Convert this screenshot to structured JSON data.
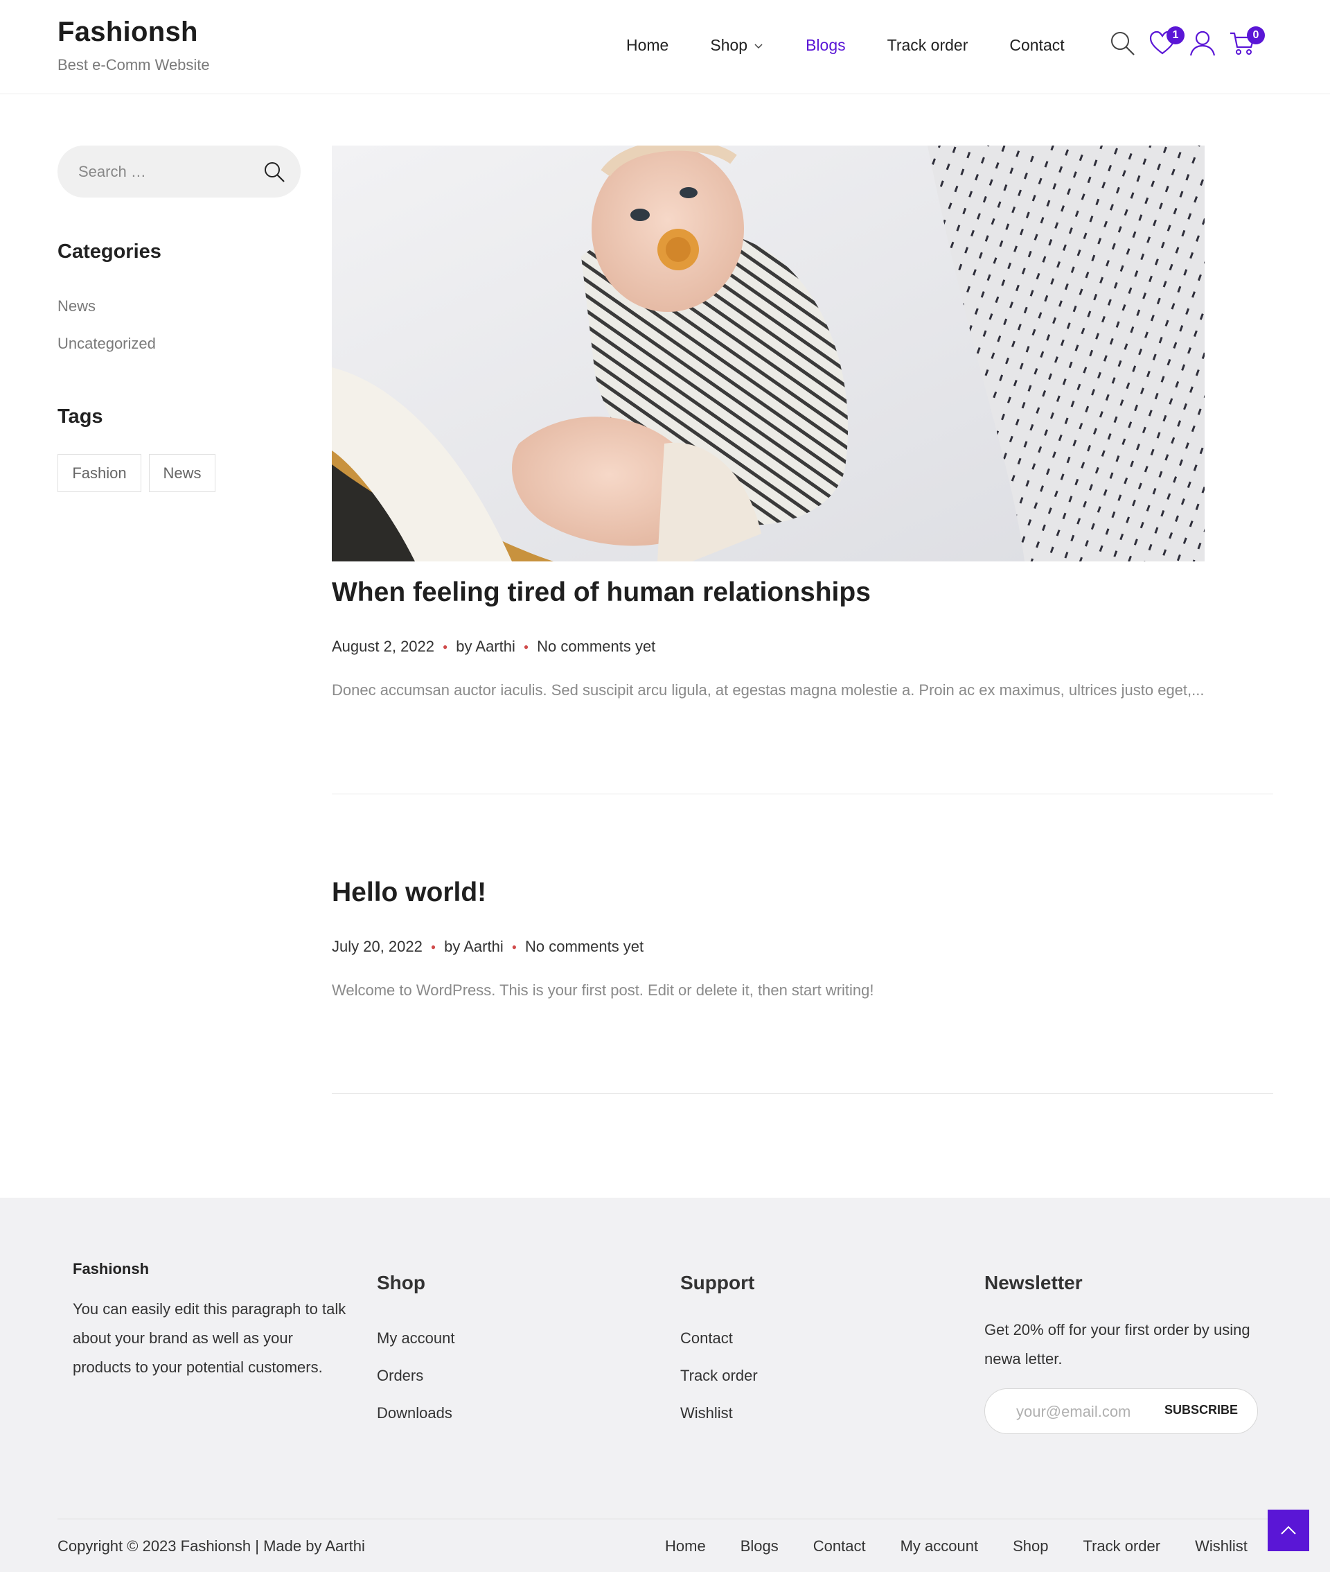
{
  "header": {
    "site_title": "Fashionsh",
    "tagline": "Best e-Comm Website",
    "nav": [
      {
        "label": "Home"
      },
      {
        "label": "Shop"
      },
      {
        "label": "Blogs"
      },
      {
        "label": "Track order"
      },
      {
        "label": "Contact"
      }
    ],
    "wishlist_count": "1",
    "cart_count": "0",
    "accent_color": "#5a16d6"
  },
  "sidebar": {
    "search_placeholder": "Search …",
    "categories_heading": "Categories",
    "categories": [
      "News",
      "Uncategorized"
    ],
    "tags_heading": "Tags",
    "tags": [
      "Fashion",
      "News"
    ]
  },
  "posts": [
    {
      "title": "When feeling tired of human relationships",
      "date": "August 2, 2022",
      "author": "by Aarthi",
      "comments": "No comments yet",
      "excerpt": "Donec accumsan auctor iaculis. Sed suscipit arcu ligula, at egestas magna molestie a. Proin ac ex maximus, ultrices justo eget,..."
    },
    {
      "title": "Hello world!",
      "date": "July 20, 2022",
      "author": "by Aarthi",
      "comments": "No comments yet",
      "excerpt": "Welcome to WordPress. This is your first post. Edit or delete it, then start writing!"
    }
  ],
  "footer": {
    "brand": "Fashionsh",
    "about": "You can easily edit this paragraph to talk about your brand as well as your products to your potential customers.",
    "shop_heading": "Shop",
    "shop_links": [
      "My account",
      "Orders",
      "Downloads"
    ],
    "support_heading": "Support",
    "support_links": [
      "Contact",
      "Track order",
      "Wishlist"
    ],
    "newsletter_heading": "Newsletter",
    "newsletter_text": "Get 20% off for your first order by using newa letter.",
    "email_placeholder": "your@email.com",
    "subscribe_label": "SUBSCRIBE",
    "copyright": "Copyright © 2023 Fashionsh | Made by Aarthi",
    "bottom_nav": [
      "Home",
      "Blogs",
      "Contact",
      "My account",
      "Shop",
      "Track order",
      "Wishlist"
    ]
  }
}
